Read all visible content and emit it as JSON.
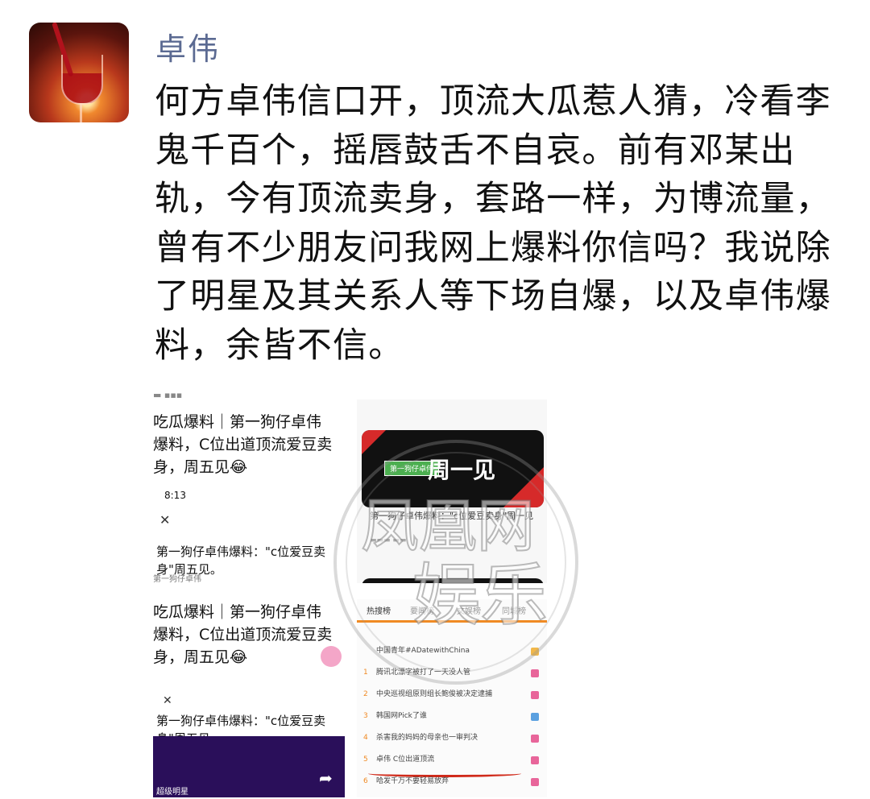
{
  "post": {
    "author": "卓伟",
    "text": "何方卓伟信口开，顶流大瓜惹人猜，冷看李鬼千百个，摇唇鼓舌不自哀。前有邓某出轨，今有顶流卖身，套路一样，为博流量，曾有不少朋友问我网上爆料你信吗？我说除了明星及其关系人等下场自爆，以及卓伟爆料，余皆不信。"
  },
  "images": [
    {
      "headline": "吃瓜爆料｜第一狗仔卓伟爆料，C位出道顶流爱豆卖身，周五见😂",
      "time": "8:13",
      "card_title": "第一狗仔卓伟爆料：\"c位爱豆卖身\"周五见。",
      "tag": "第一狗仔卓伟"
    },
    {
      "card_text": "周一见",
      "badge_text": "第一狗仔卓伟",
      "caption": "第一狗仔卓伟爆料：\"c位爱豆卖身\"周一见"
    },
    {
      "headline": "吃瓜爆料｜第一狗仔卓伟爆料，C位出道顶流爱豆卖身，周五见😂",
      "card_title": "第一狗仔卓伟爆料：\"c位爱豆卖身\"周五见。",
      "bottom_text": "超级明星"
    },
    {
      "tabs": [
        "热搜榜",
        "要闻榜",
        "文娱榜",
        "同城榜"
      ],
      "rows": [
        {
          "num": "",
          "text": "中国青年#ADatewithChina",
          "badge": "#f2b84a"
        },
        {
          "num": "1",
          "text": "腾讯北漂字被打了一天没人管",
          "badge": "#e8659a"
        },
        {
          "num": "2",
          "text": "中央巡视组原则组长鲍俊被决定逮捕",
          "badge": "#e8659a"
        },
        {
          "num": "3",
          "text": "韩国网Pick了谁",
          "badge": "#5aa0e0"
        },
        {
          "num": "4",
          "text": "杀害我的妈妈的母亲也一审判决",
          "badge": "#e8659a"
        },
        {
          "num": "5",
          "text": "卓伟 C位出道顶流",
          "badge": "#e8659a"
        },
        {
          "num": "6",
          "text": "哈发千万不要轻易放弃",
          "badge": "#e8659a"
        }
      ]
    }
  ],
  "watermark": "凤凰网娱乐",
  "colors": {
    "author": "#5b6a92",
    "accent": "#f08a24"
  }
}
